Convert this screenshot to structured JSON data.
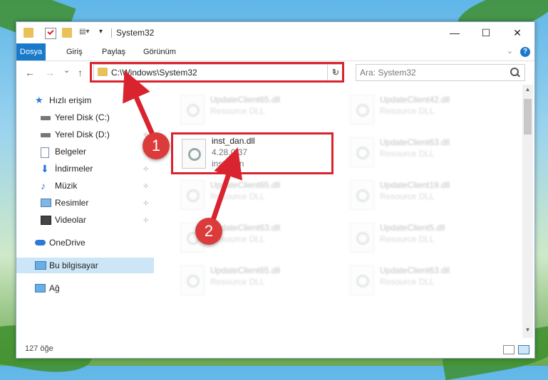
{
  "window": {
    "title": "System32",
    "controls": {
      "minimize": "—",
      "maximize": "☐",
      "close": "✕"
    }
  },
  "ribbon": {
    "tabs": [
      {
        "label": "Dosya",
        "active": true
      },
      {
        "label": "Giriş"
      },
      {
        "label": "Paylaş"
      },
      {
        "label": "Görünüm"
      }
    ],
    "help_label": "?"
  },
  "nav": {
    "back": "←",
    "forward": "→",
    "recent": "⌄",
    "up": "↑",
    "address": "C:\\Windows\\System32",
    "address_dropdown": "⌄",
    "refresh": "↻",
    "search_placeholder": "Ara: System32"
  },
  "sidebar": {
    "items": [
      {
        "label": "Hızlı erişim",
        "icon": "star-icon"
      },
      {
        "label": "Yerel Disk (C:)",
        "icon": "drive-icon",
        "pin": "⊹"
      },
      {
        "label": "Yerel Disk (D:)",
        "icon": "drive-icon",
        "pin": "⊹"
      },
      {
        "label": "Belgeler",
        "icon": "documents-icon",
        "pin": "⊹"
      },
      {
        "label": "İndirmeler",
        "icon": "downloads-icon",
        "pin": "⊹"
      },
      {
        "label": "Müzik",
        "icon": "music-icon",
        "pin": "⊹"
      },
      {
        "label": "Resimler",
        "icon": "pictures-icon",
        "pin": "⊹"
      },
      {
        "label": "Videolar",
        "icon": "videos-icon",
        "pin": "⊹"
      },
      {
        "label": "OneDrive",
        "icon": "cloud-icon"
      },
      {
        "label": "Bu bilgisayar",
        "icon": "computer-icon",
        "selected": true
      },
      {
        "label": "Ağ",
        "icon": "network-icon"
      }
    ]
  },
  "files": {
    "highlighted": {
      "name": "inst_dan.dll",
      "version": "4.28.0.37",
      "description": "inst_dan"
    },
    "background": [
      {
        "name": "UpdateClient65.dll",
        "type": "Resource DLL"
      },
      {
        "name": "UpdateClient42.dll",
        "type": "Resource DLL"
      },
      {
        "name": "UpdateClient63.dll",
        "type": "Resource DLL"
      },
      {
        "name": "UpdateClient65.dll",
        "type": "Resource DLL"
      },
      {
        "name": "UpdateClient19.dll",
        "type": "Resource DLL"
      },
      {
        "name": "UpdateClient63.dll",
        "type": "Resource DLL"
      },
      {
        "name": "UpdateClient5.dll",
        "type": "Resource DLL"
      },
      {
        "name": "UpdateClient65.dll",
        "type": "Resource DLL"
      },
      {
        "name": "UpdateClient63.dll",
        "type": "Resource DLL"
      }
    ]
  },
  "status": {
    "count": "127 öğe"
  },
  "annotations": {
    "step1": "1",
    "step2": "2",
    "color": "#d9232e"
  }
}
